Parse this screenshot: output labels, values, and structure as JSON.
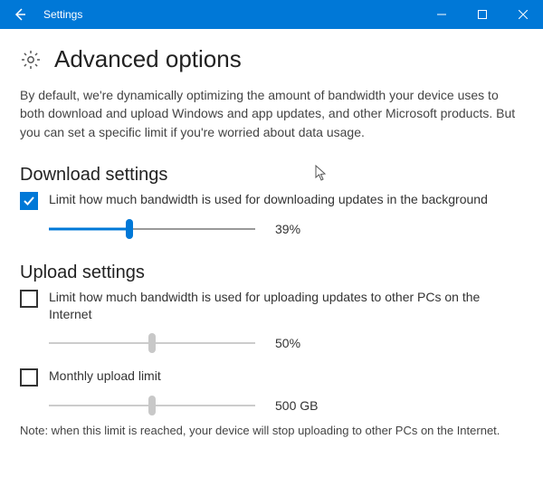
{
  "titlebar": {
    "title": "Settings"
  },
  "page": {
    "heading": "Advanced options",
    "intro": "By default, we're dynamically optimizing the amount of bandwidth your device uses to both download and upload Windows and app updates, and other Microsoft products. But you can set a specific limit if you're worried about data usage."
  },
  "download": {
    "title": "Download settings",
    "check_label": "Limit how much bandwidth is used for downloading updates in the background",
    "checked": true,
    "slider_percent": 39,
    "slider_display": "39%"
  },
  "upload": {
    "title": "Upload settings",
    "check_label": "Limit how much bandwidth is used for uploading updates to other PCs on the Internet",
    "checked": false,
    "slider_percent": 50,
    "slider_display": "50%",
    "monthly_label": "Monthly upload limit",
    "monthly_checked": false,
    "monthly_slider_percent": 50,
    "monthly_slider_display": "500 GB"
  },
  "note": "Note: when this limit is reached, your device will stop uploading to other PCs on the Internet."
}
